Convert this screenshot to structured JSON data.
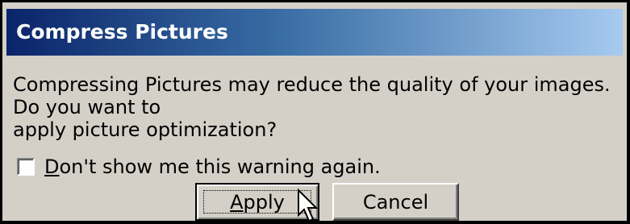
{
  "dialog": {
    "title": "Compress Pictures",
    "message": "Compressing Pictures may reduce the quality of your images. Do you want to\napply picture optimization?",
    "checkbox": {
      "checked": false,
      "label_mnemonic": "D",
      "label_rest": "on't show me this warning again."
    },
    "buttons": {
      "apply_mnemonic": "A",
      "apply_rest": "pply",
      "cancel": "Cancel"
    }
  },
  "colors": {
    "titlebar_start": "#0a246a",
    "titlebar_end": "#a6caf0",
    "dialog_background": "#d4d0c8"
  },
  "icons": {
    "cursor": "arrow-cursor-icon"
  }
}
